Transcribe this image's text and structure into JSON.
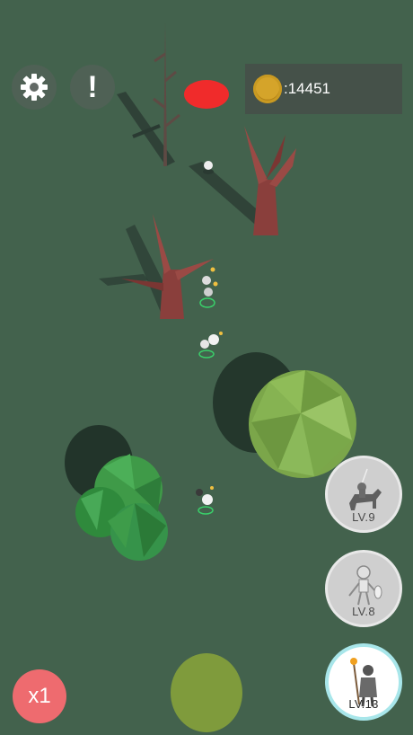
{
  "hud": {
    "settings_icon": "gear-icon",
    "info_label": "!",
    "coin_icon": "coin-icon",
    "coins": ":14451",
    "record_color": "#f02b2b"
  },
  "unit_cards": [
    {
      "unit": "cavalry-knight",
      "level": "LV.9"
    },
    {
      "unit": "skeleton-warrior",
      "level": "LV.8"
    },
    {
      "unit": "wizard",
      "level": "LV.13"
    }
  ],
  "speed": {
    "label": "x1"
  },
  "colors": {
    "ground": "#43624d",
    "speed_button": "#ee6b6f",
    "joystick": "#7f9b3c",
    "selected_ring": "#a8e6ea"
  }
}
